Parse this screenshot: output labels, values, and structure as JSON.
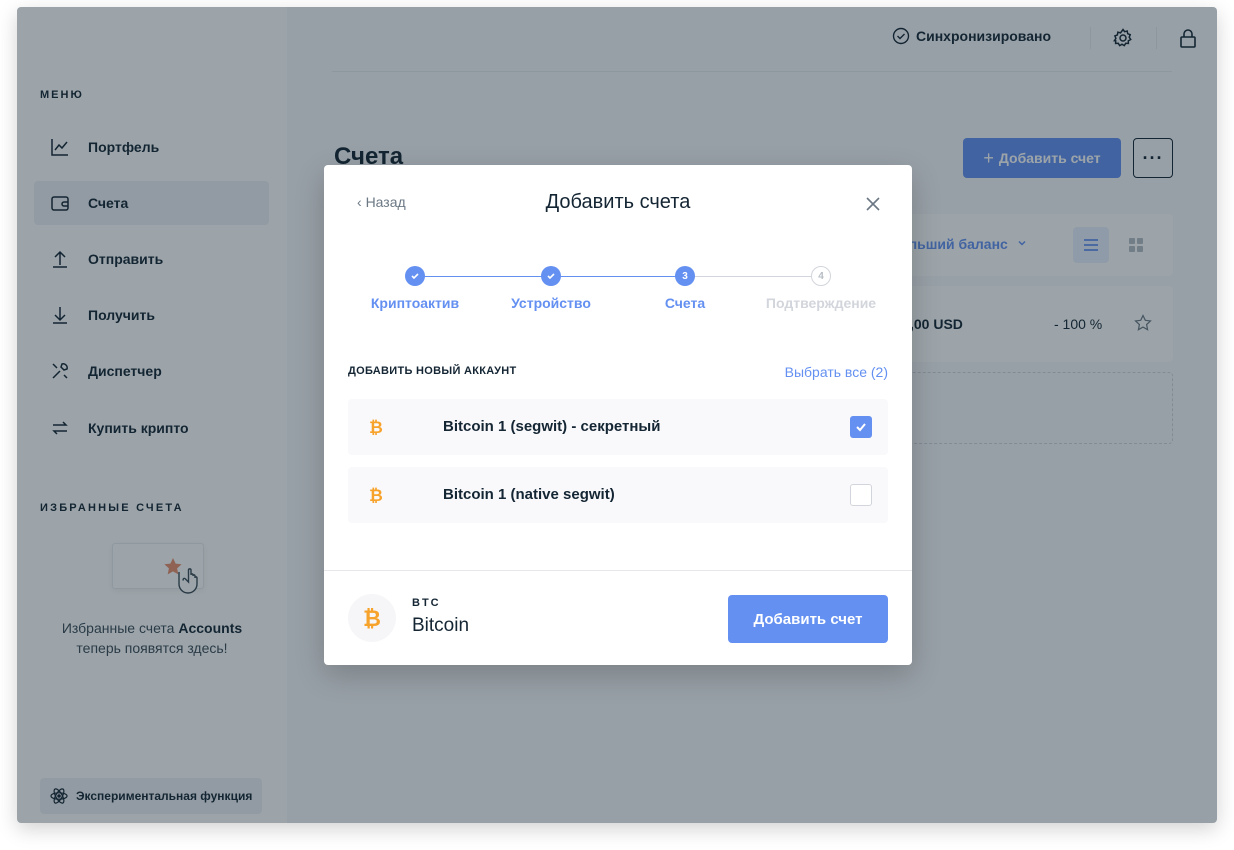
{
  "sidebar": {
    "menu_title": "МЕНЮ",
    "items": [
      {
        "label": "Портфель",
        "icon": "portfolio-chart-icon"
      },
      {
        "label": "Счета",
        "icon": "wallet-icon"
      },
      {
        "label": "Отправить",
        "icon": "arrow-up-icon"
      },
      {
        "label": "Получить",
        "icon": "arrow-down-icon"
      },
      {
        "label": "Диспетчер",
        "icon": "tools-icon"
      },
      {
        "label": "Купить крипто",
        "icon": "swap-arrows-icon"
      }
    ],
    "favorites_title": "ИЗБРАННЫЕ СЧЕТА",
    "favorites_text_prefix": "Избранные счета",
    "favorites_text_bold": "Accounts",
    "favorites_text_suffix": "теперь появятся здесь!",
    "experimental_label": "Экспериментальная функция"
  },
  "topbar": {
    "sync_label": "Синхронизировано"
  },
  "main": {
    "page_title": "Счета",
    "add_account_label": "Добавить счет",
    "more_label": "···",
    "sort_label": "ольший баланс",
    "account_balance": ",00 USD",
    "account_change": "- 100 %"
  },
  "modal": {
    "back_label": "Назад",
    "title": "Добавить счета",
    "steps": [
      {
        "num": "1",
        "label": "Криптоактив",
        "state": "done"
      },
      {
        "num": "2",
        "label": "Устройство",
        "state": "done"
      },
      {
        "num": "3",
        "label": "Счета",
        "state": "active"
      },
      {
        "num": "4",
        "label": "Подтверждение",
        "state": "pending"
      }
    ],
    "section_title": "ДОБАВИТЬ НОВЫЙ АККАУНТ",
    "select_all": "Выбрать все (2)",
    "accounts": [
      {
        "name": "Bitcoin 1 (segwit) - секретный",
        "checked": true
      },
      {
        "name": "Bitcoin 1 (native segwit)",
        "checked": false
      }
    ],
    "footer": {
      "ticker": "BTC",
      "currency": "Bitcoin",
      "button": "Добавить счет"
    }
  },
  "colors": {
    "accent": "#6490f1",
    "bitcoin": "#f7a32b",
    "text": "#142533"
  }
}
